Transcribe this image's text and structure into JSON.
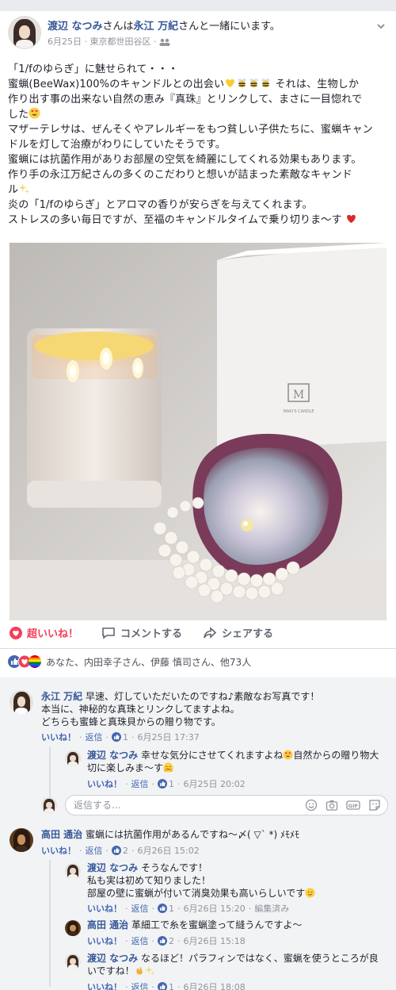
{
  "post": {
    "author": "渡辺 なつみ",
    "header_mid": "さんは",
    "tagged": "永江 万紀",
    "header_end": "さんと一緒にいます。",
    "date": "6月25日",
    "location": "東京都世田谷区",
    "text_1": "「1/fのゆらぎ」に魅せられて・・・",
    "text_2a": "蜜蝋(BeeWax)100%のキャンドルとの出会い",
    "text_2b": "それは、生物しか",
    "text_3": "作り出す事の出来ない自然の恵み『真珠』とリンクして、まさに一目惚れで",
    "text_4": "した",
    "text_5": "マザーテレサは、ぜんそくやアレルギーをもつ貧しい子供たちに、蜜蝋キャン",
    "text_6": "ドルを灯して治療がわりにしていたそうです。",
    "text_7": "蜜蝋には抗菌作用がありお部屋の空気を綺麗にしてくれる効果もあります。",
    "text_8": "作り手の永江万紀さんの多くのこだわりと想いが詰まった素敵なキャンド",
    "text_9": "ル",
    "text_10": "炎の「1/fのゆらぎ」とアロマの香りが安らぎを与えてくれます。",
    "text_11": "ストレスの多い毎日ですが、至福のキャンドルタイムで乗り切りま〜す",
    "box_logo_text": "MAKI'S CANDLE"
  },
  "actions": {
    "like_label": "超いいね！",
    "comment_label": "コメントする",
    "share_label": "シェアする"
  },
  "reactions": {
    "summary": "あなた、内田幸子さん、伊藤 慎司さん、他73人"
  },
  "comments": [
    {
      "author": "永江 万紀",
      "line1": "早速、灯していただいたのですね♪素敵なお写真です！",
      "line2": "本当に、神秘的な真珠とリンクしてますよね。",
      "line3": "どちらも蜜蜂と真珠貝からの贈り物です。",
      "like": "いいね！",
      "reply": "返信",
      "count": "1",
      "time": "6月25日 17:37"
    },
    {
      "author": "渡辺 なつみ",
      "line1": "幸せな気分にさせてくれますよね",
      "line1b": "自然からの贈り物大",
      "line2": "切に楽しみま〜す",
      "like": "いいね！",
      "reply": "返信",
      "count": "1",
      "time": "6月25日 20:02"
    },
    {
      "author": "高田 通治",
      "line1": "蜜蝋には抗菌作用があるんですね〜〆( ▽` *) ﾒﾓﾒﾓ",
      "like": "いいね！",
      "reply": "返信",
      "count": "2",
      "time": "6月26日 15:02"
    },
    {
      "author": "渡辺 なつみ",
      "line1": "そうなんです！",
      "line2": "私も実は初めて知りました！",
      "line3": "部屋の壁に蜜蝋が付いて消臭効果も高いらしいです",
      "like": "いいね！",
      "reply": "返信",
      "count": "1",
      "time": "6月26日 15:20",
      "edited": "編集済み"
    },
    {
      "author": "高田 通治",
      "line1": "革細工で糸を蜜蝋塗って縫うんですよ〜",
      "like": "いいね！",
      "reply": "返信",
      "count": "2",
      "time": "6月26日 15:18"
    },
    {
      "author": "渡辺 なつみ",
      "line1": "なるほど！パラフィンではなく、蜜蝋を使うところが良",
      "line2": "いですね！",
      "like": "いいね！",
      "reply": "返信",
      "count": "1",
      "time": "6月26日 18:08"
    }
  ],
  "reply_box": {
    "placeholder": "返信する..."
  },
  "colors": {
    "link": "#365899",
    "love": "#f33e58",
    "meta": "#90949c",
    "like_blue": "#4267b2"
  }
}
